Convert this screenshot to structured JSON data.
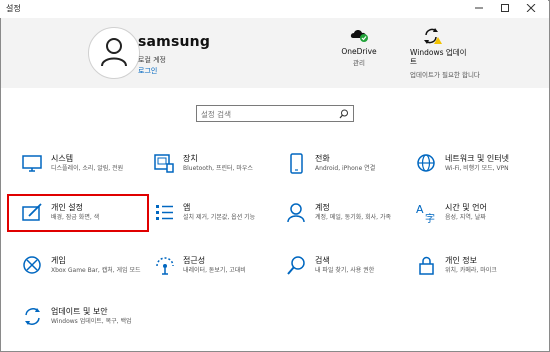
{
  "window": {
    "title": "설정"
  },
  "user": {
    "name": "samsung",
    "account_type": "로컬 계정",
    "sign_in_link": "로그인"
  },
  "services": [
    {
      "name": "OneDrive",
      "sub": "관리"
    },
    {
      "name": "Windows 업데이트",
      "sub": "업데이트가 필요한 합니다"
    }
  ],
  "search": {
    "placeholder": "설정 검색"
  },
  "tiles": [
    {
      "label": "시스템",
      "desc": "디스플레이, 소리, 알림, 전원"
    },
    {
      "label": "장치",
      "desc": "Bluetooth, 프린터, 마우스"
    },
    {
      "label": "전화",
      "desc": "Android, iPhone 연결"
    },
    {
      "label": "네트워크 및 인터넷",
      "desc": "Wi-Fi, 비행기 모드, VPN"
    },
    {
      "label": "개인 설정",
      "desc": "배경, 잠금 화면, 색"
    },
    {
      "label": "앱",
      "desc": "설치 제거, 기본값, 옵션 기능"
    },
    {
      "label": "계정",
      "desc": "계정, 메일, 동기화, 회사, 가족"
    },
    {
      "label": "시간 및 언어",
      "desc": "음성, 지역, 날짜"
    },
    {
      "label": "게임",
      "desc": "Xbox Game Bar, 캡처, 게임 모드"
    },
    {
      "label": "접근성",
      "desc": "내레이터, 돋보기, 고대비"
    },
    {
      "label": "검색",
      "desc": "내 파일 찾기, 사용 권한"
    },
    {
      "label": "개인 정보",
      "desc": "위치, 카메라, 마이크"
    },
    {
      "label": "업데이트 및 보안",
      "desc": "Windows 업데이트, 복구, 백업"
    }
  ],
  "colors": {
    "accent": "#0067c0",
    "highlight": "#e00000",
    "header_bg": "#f3f3f3"
  },
  "icons": [
    "settings-title",
    "person-icon",
    "onedrive-icon",
    "windows-update-icon",
    "search-icon",
    "system-icon",
    "devices-icon",
    "phone-icon",
    "network-icon",
    "personalization-icon",
    "apps-icon",
    "accounts-icon",
    "time-language-icon",
    "gaming-icon",
    "ease-of-access-icon",
    "search-tile-icon",
    "privacy-icon",
    "update-security-icon"
  ]
}
